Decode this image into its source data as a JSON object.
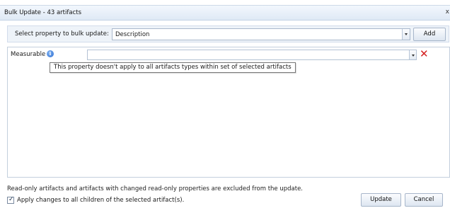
{
  "window": {
    "title": "Bulk Update - 43 artifacts",
    "close_glyph": "x"
  },
  "property_bar": {
    "label": "Select property to bulk update:",
    "selected_value": "Description",
    "add_label": "Add"
  },
  "property_rows": [
    {
      "label": "Measurable",
      "info_icon": "info-icon",
      "value": "",
      "remove_glyph": "✕",
      "tooltip": "This property doesn't apply to all artifacts types within set of selected artifacts"
    }
  ],
  "footer": {
    "note": "Read-only artifacts and artifacts with changed read-only properties are excluded from the update.",
    "apply_children_label": "Apply changes to all children of the selected artifact(s).",
    "apply_children_checked": true,
    "update_label": "Update",
    "cancel_label": "Cancel"
  },
  "colors": {
    "titlebar": "#dfe9f5",
    "property_bar": "#eef3f9",
    "remove": "#d42020",
    "info": "#2f6fd2"
  }
}
